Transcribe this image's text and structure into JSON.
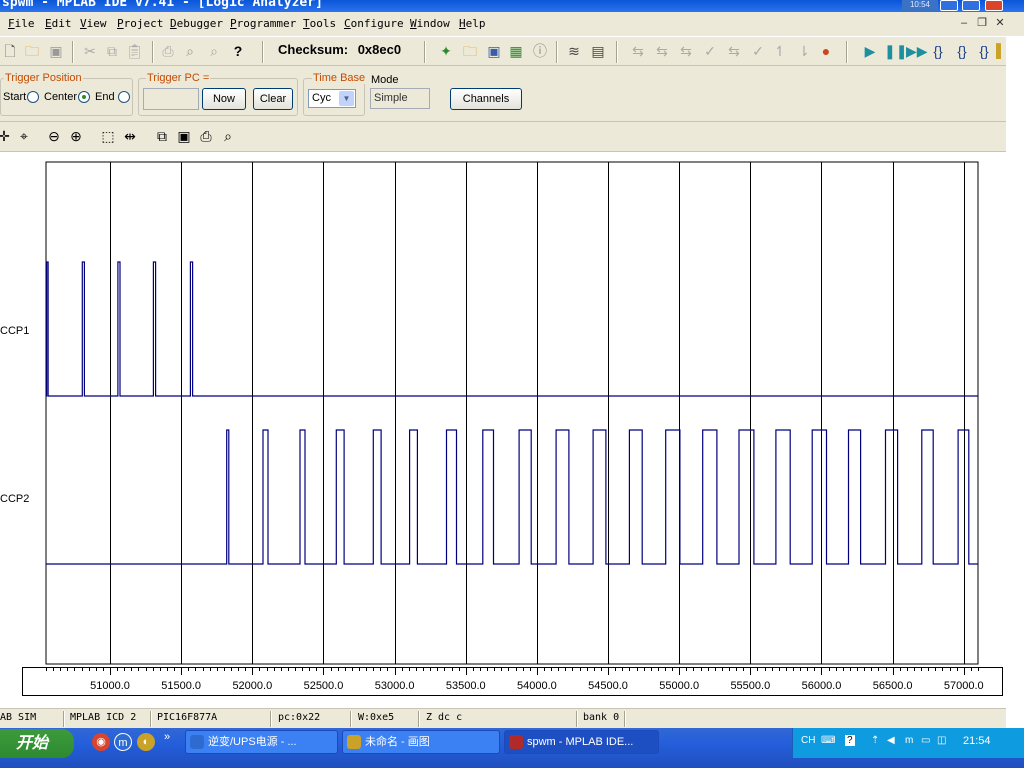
{
  "window": {
    "title": "spwm - MPLAB IDE v7.41 - [Logic Analyzer]",
    "clock_tile": "10:54"
  },
  "menu": [
    "File",
    "Edit",
    "View",
    "Project",
    "Debugger",
    "Programmer",
    "Tools",
    "Configure",
    "Window",
    "Help"
  ],
  "toolbar": {
    "checksum_label": "Checksum:",
    "checksum_value": "0x8ec0"
  },
  "trigger": {
    "position_label": "Trigger Position",
    "start": "Start",
    "center": "Center",
    "end": "End",
    "selected": "Center",
    "pc_label": "Trigger PC =",
    "pc_value": "",
    "now": "Now",
    "clear": "Clear"
  },
  "time_base": {
    "label": "Time Base",
    "value": "Cyc"
  },
  "mode": {
    "label": "Mode",
    "value": "Simple"
  },
  "channels_button": "Channels",
  "chart_data": {
    "type": "line",
    "channels": [
      "CCP1",
      "CCP2"
    ],
    "x_ticks": [
      "51000.0",
      "51500.0",
      "52000.0",
      "52500.0",
      "53000.0",
      "53500.0",
      "54000.0",
      "54500.0",
      "55000.0",
      "55500.0",
      "56000.0",
      "56500.0",
      "57000.0"
    ],
    "xlim": [
      50550,
      57100
    ],
    "grid_step": 500,
    "line_color": "#000080",
    "series": [
      {
        "name": "CCP1",
        "high_intervals": [
          [
            50555,
            50565
          ],
          [
            50805,
            50820
          ],
          [
            51055,
            51070
          ],
          [
            51305,
            51320
          ],
          [
            51565,
            51580
          ]
        ]
      },
      {
        "name": "CCP2",
        "high_intervals": [
          [
            51820,
            51835
          ],
          [
            52075,
            52110
          ],
          [
            52335,
            52370
          ],
          [
            52590,
            52645
          ],
          [
            52850,
            52905
          ],
          [
            53105,
            53160
          ],
          [
            53365,
            53435
          ],
          [
            53620,
            53695
          ],
          [
            53875,
            53960
          ],
          [
            54135,
            54225
          ],
          [
            54395,
            54485
          ],
          [
            54650,
            54740
          ],
          [
            54905,
            55005
          ],
          [
            55165,
            55265
          ],
          [
            55420,
            55525
          ],
          [
            55680,
            55780
          ],
          [
            55935,
            56035
          ],
          [
            56190,
            56275
          ],
          [
            56450,
            56535
          ],
          [
            56705,
            56785
          ],
          [
            56960,
            57035
          ]
        ]
      }
    ]
  },
  "status": {
    "sim": "AB SIM",
    "debugger": "MPLAB ICD 2",
    "device": "PIC16F877A",
    "pc": "pc:0x22",
    "w": "W:0xe5",
    "flags": "Z dc c",
    "bank": "bank 0"
  },
  "taskbar": {
    "start": "开始",
    "tasks": [
      "逆变/UPS电源 - ...",
      "未命名 - 画图",
      "spwm - MPLAB IDE..."
    ],
    "active_task": 2,
    "lang": "CH",
    "time": "21:54"
  }
}
